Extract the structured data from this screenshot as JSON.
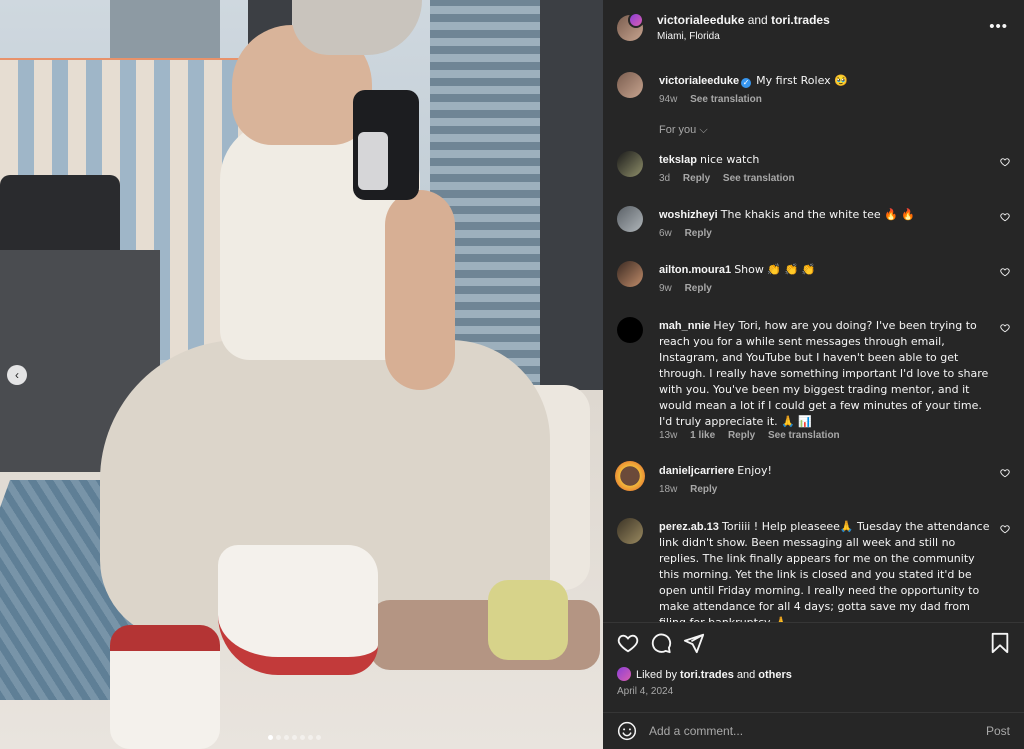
{
  "photo": {
    "carousel_prev_label": "‹",
    "carousel_dots": 7,
    "carousel_active_index": 0
  },
  "header": {
    "user1": "victorialeeduke",
    "connector": " and ",
    "user2": "tori.trades",
    "location": "Miami, Florida",
    "more_label": "•••"
  },
  "caption": {
    "username": "victorialeeduke",
    "text": "My first Rolex 🥹",
    "age": "94w",
    "see_translation": "See translation"
  },
  "for_you": "For you ⌵",
  "comments": [
    {
      "username": "tekslap",
      "text": "nice watch",
      "age": "3d",
      "likes": "",
      "reply": "Reply",
      "see_translation": "See translation"
    },
    {
      "username": "woshizheyi",
      "text": "The khakis and the white tee 🔥 🔥",
      "age": "6w",
      "likes": "",
      "reply": "Reply",
      "see_translation": ""
    },
    {
      "username": "ailton.moura1",
      "text": "Show 👏 👏 👏",
      "age": "9w",
      "likes": "",
      "reply": "Reply",
      "see_translation": ""
    },
    {
      "username": "mah_nnie",
      "text": "Hey Tori, how are you doing? I've been trying to reach you for a while sent messages through email, Instagram, and YouTube but I haven't been able to get through. I really have something important I'd love to share with you. You've been my biggest trading mentor, and it would mean a lot if I could get a few minutes of your time. I'd truly appreciate it. 🙏 📊",
      "age": "13w",
      "likes": "1 like",
      "reply": "Reply",
      "see_translation": "See translation"
    },
    {
      "username": "danieljcarriere",
      "text": "Enjoy!",
      "age": "18w",
      "likes": "",
      "reply": "Reply",
      "see_translation": ""
    },
    {
      "username": "perez.ab.13",
      "text": "Toriiii ! Help pleaseee🙏 Tuesday the attendance link didn't show. Been messaging all week and still no replies. The link finally appears for me on the community this morning. Yet the link is closed and you stated it'd be open until Friday morning. I really need the opportunity to make attendance for all 4 days; gotta save my dad from filing for bankruptcy 🙏",
      "age": "",
      "likes": "",
      "reply": "",
      "see_translation": ""
    }
  ],
  "likes": {
    "prefix": "Liked by ",
    "user": "tori.trades",
    "middle": " and ",
    "others": "others"
  },
  "date": "April 4, 2024",
  "add_comment": {
    "placeholder": "Add a comment...",
    "post_label": "Post"
  },
  "icons": [
    "heart-icon",
    "comment-icon",
    "share-icon",
    "bookmark-icon",
    "smiley-icon",
    "verified-badge-icon",
    "more-icon"
  ],
  "colors": {
    "panel_bg": "#262626",
    "text": "#f5f5f5",
    "muted": "#a8a8a8",
    "verified": "#3897f0"
  }
}
